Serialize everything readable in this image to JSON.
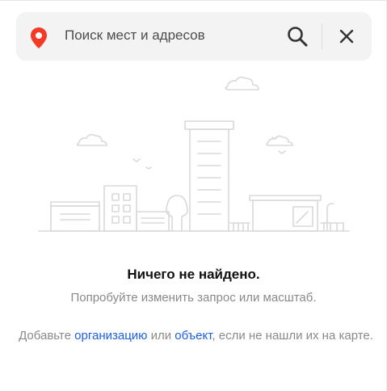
{
  "search": {
    "placeholder": "Поиск мест и адресов",
    "pin_icon": "location-pin-icon",
    "search_icon": "search-icon",
    "close_icon": "close-icon",
    "pin_color": "#f33a25"
  },
  "empty_state": {
    "title": "Ничего не найдено.",
    "subtitle": "Попробуйте изменить запрос или масштаб.",
    "hint_prefix": "Добавьте ",
    "link_organization": "организацию",
    "hint_or": " или ",
    "link_object": "объект",
    "hint_suffix": ", если не нашли их на карте.",
    "illustration": "city-buildings-illustration"
  },
  "colors": {
    "link": "#1a5ee8",
    "muted_text": "#8a8a8a",
    "search_bg": "#f3f3f3"
  }
}
